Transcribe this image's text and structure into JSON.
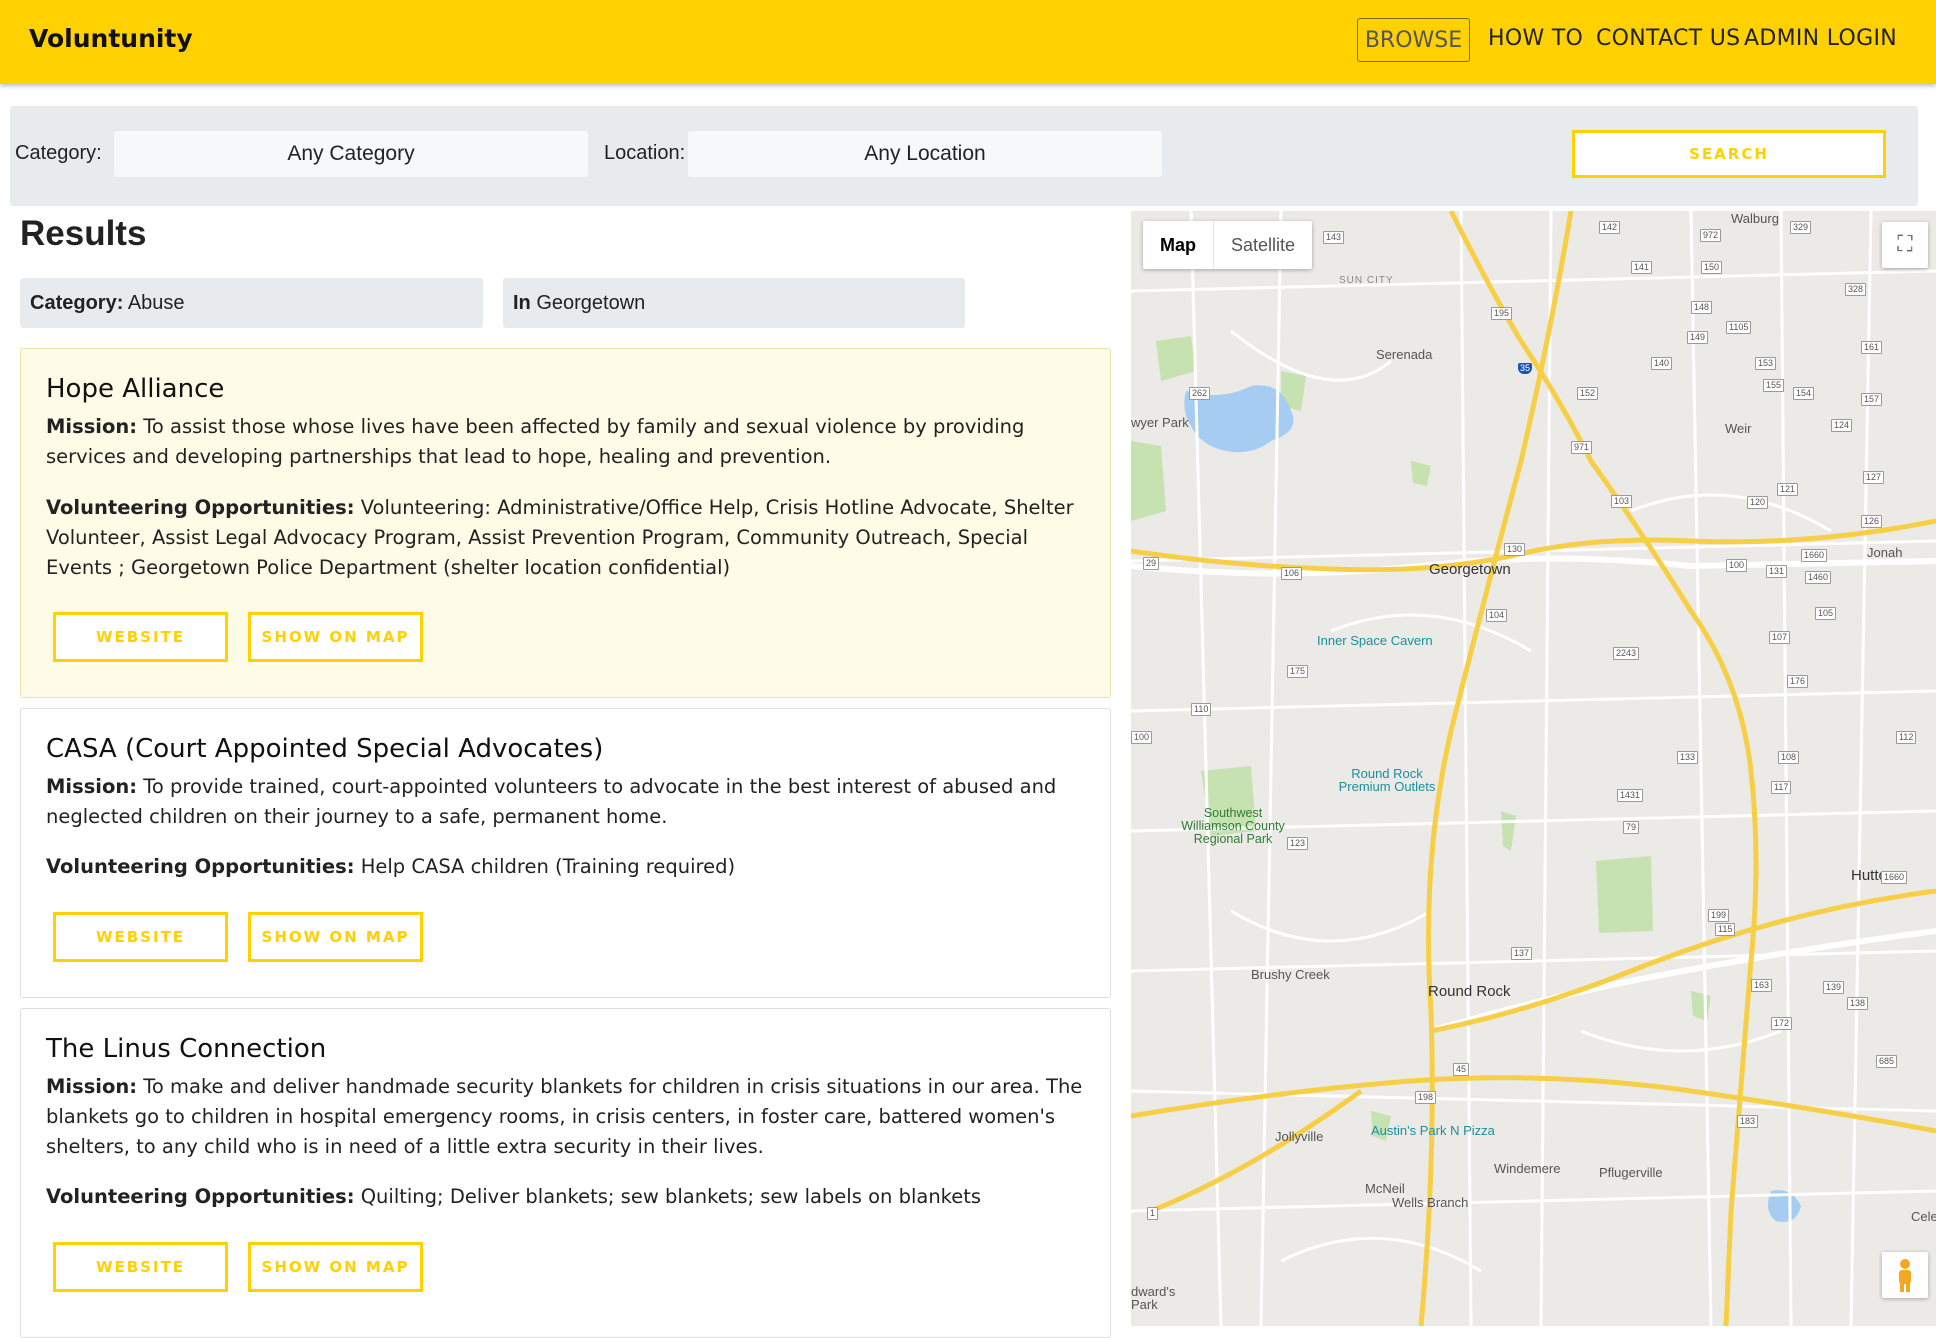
{
  "navbar": {
    "brand": "Voluntunity",
    "links": [
      "BROWSE",
      "HOW TO",
      "CONTACT US",
      "ADMIN LOGIN"
    ]
  },
  "search": {
    "category_label": "Category:",
    "category_value": "Any Category",
    "location_label": "Location:",
    "location_value": "Any Location",
    "search_button": "SEARCH"
  },
  "results": {
    "title": "Results",
    "filter_category_label": "Category:",
    "filter_category_value": "Abuse",
    "filter_location_label": "In",
    "filter_location_value": "Georgetown",
    "mission_label": "Mission:",
    "opps_label": "Volunteering Opportunities:",
    "website_button": "WEBSITE",
    "map_button": "SHOW ON MAP",
    "items": [
      {
        "name": "Hope Alliance",
        "mission": "To assist those whose lives have been affected by family and sexual violence by providing services and developing partnerships that lead to hope, healing and prevention.",
        "opportunities": "Volunteering: Administrative/Office Help, Crisis Hotline Advocate, Shelter Volunteer, Assist Legal Advocacy Program, Assist Prevention Program, Community Outreach, Special Events ; Georgetown Police Department (shelter location confidential)"
      },
      {
        "name": "CASA (Court Appointed Special Advocates)",
        "mission": "To provide trained, court-appointed volunteers to advocate in the best interest of abused and neglected children on their journey to a safe, permanent home.",
        "opportunities": "Help CASA children (Training required)"
      },
      {
        "name": "The Linus Connection",
        "mission": "To make and deliver handmade security blankets for children in crisis situations in our area. The blankets go to children in hospital emergency rooms, in crisis centers, in foster care, battered women's shelters, to any child who is in need of a little extra security in their lives.",
        "opportunities": "Quilting; Deliver blankets; sew blankets; sew labels on blankets"
      }
    ]
  },
  "map": {
    "type_map": "Map",
    "type_satellite": "Satellite",
    "places": [
      "Walburg",
      "SUN CITY",
      "Serenada",
      "Weir",
      "Jonah",
      "Georgetown",
      "Inner Space Cavern",
      "Round Rock Premium Outlets",
      "Southwest Williamson County Regional Park",
      "Hutto",
      "Brushy Creek",
      "Round Rock",
      "Jollyville",
      "Austin's Park N Pizza",
      "Windemere",
      "Pflugerville",
      "McNeil",
      "Wells Branch",
      "wyer Park",
      "dward's Park",
      "Cele"
    ],
    "road_shields": [
      "143",
      "142",
      "972",
      "329",
      "141",
      "150",
      "328",
      "195",
      "148",
      "1105",
      "149",
      "161",
      "140",
      "153",
      "262",
      "35",
      "152",
      "155",
      "154",
      "157",
      "971",
      "124",
      "127",
      "121",
      "103",
      "120",
      "126",
      "29",
      "130",
      "106",
      "100",
      "1660",
      "131",
      "1460",
      "105",
      "104",
      "107",
      "2243",
      "176",
      "175",
      "110",
      "100",
      "133",
      "108",
      "112",
      "117",
      "1431",
      "79",
      "123",
      "199",
      "115",
      "1660",
      "137",
      "163",
      "139",
      "138",
      "172",
      "45",
      "198",
      "685",
      "183",
      "1"
    ],
    "colors": {
      "land": "#ebeae6",
      "highway": "#f6cf47",
      "road": "#ffffff",
      "water": "#a6cdf1",
      "park": "#c7e2b1"
    }
  }
}
